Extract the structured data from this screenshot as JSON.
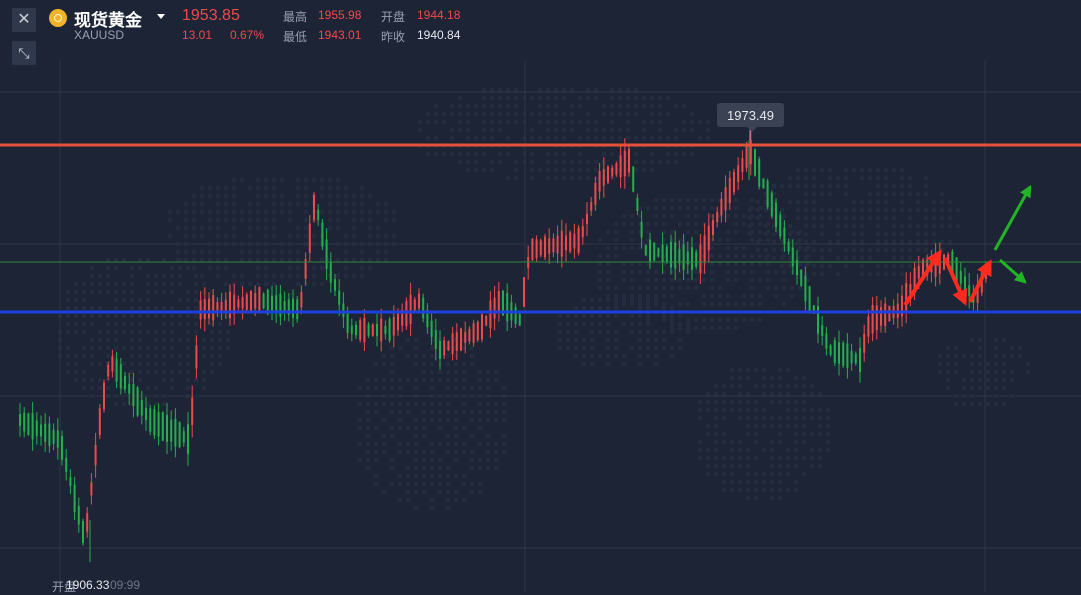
{
  "instrument": {
    "name": "现货黄金",
    "code": "XAUUSD",
    "price": "1953.85",
    "change": "13.01",
    "change_pct": "0.67%",
    "high_label": "最高",
    "high_value": "1955.98",
    "open_label": "开盘",
    "open_value": "1944.18",
    "low_label": "最低",
    "low_value": "1943.01",
    "prev_close_label": "昨收",
    "prev_close_value": "1940.84"
  },
  "controls": {
    "close_icon": "close-icon",
    "collapse_icon": "collapse-icon",
    "dropdown_icon": "chevron-down-icon"
  },
  "chart": {
    "max_tip": "1973.49",
    "min_label": "1906.33",
    "bottom_left_label": "开盘",
    "bottom_left_time": "09:99",
    "resistance_color": "#e8503a",
    "support_color": "#1d3fe0",
    "up_color": "#ef4a4a",
    "down_color": "#22b04a"
  }
}
